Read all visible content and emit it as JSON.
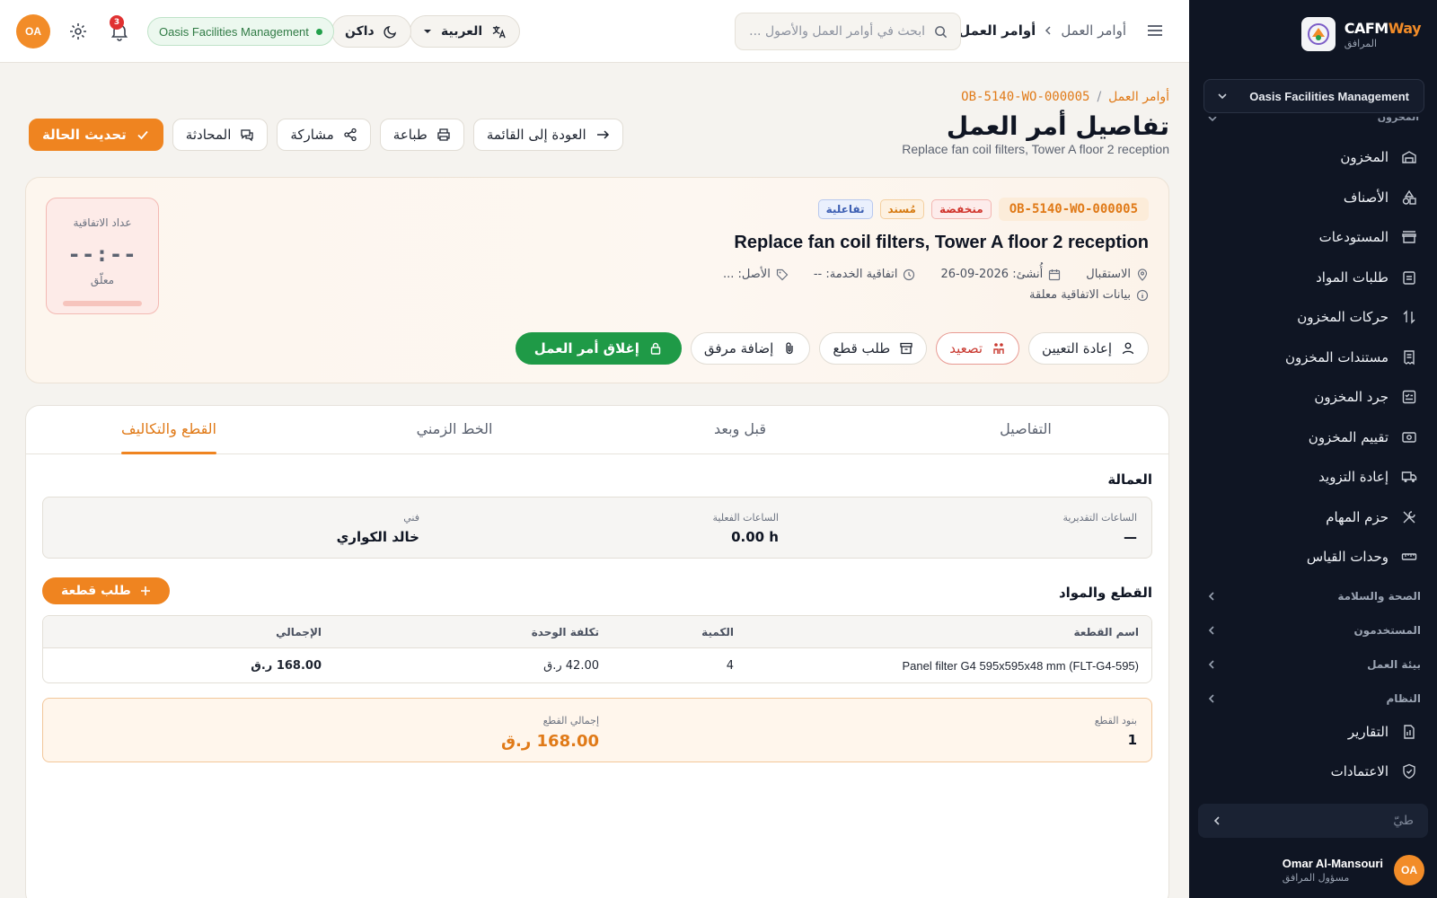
{
  "app": {
    "brand_prefix": "CAFM",
    "brand_suffix": "Way",
    "brand_sub": "المرافق"
  },
  "sidebar": {
    "org": "Oasis Facilities Management",
    "cut_label": "المخزون",
    "items": [
      {
        "label": "المخزون",
        "icon": "warehouse-icon"
      },
      {
        "label": "الأصناف",
        "icon": "shapes-icon"
      },
      {
        "label": "المستودعات",
        "icon": "store-icon"
      },
      {
        "label": "طلبات المواد",
        "icon": "clipboard-icon"
      },
      {
        "label": "حركات المخزون",
        "icon": "arrows-updown-icon"
      },
      {
        "label": "مستندات المخزون",
        "icon": "receipt-icon"
      },
      {
        "label": "جرد المخزون",
        "icon": "checklist-icon"
      },
      {
        "label": "تقييم المخزون",
        "icon": "coins-icon"
      },
      {
        "label": "إعادة التزويد",
        "icon": "truck-icon"
      },
      {
        "label": "حزم المهام",
        "icon": "tools-icon"
      },
      {
        "label": "وحدات القياس",
        "icon": "ruler-icon"
      }
    ],
    "groups": [
      "الصحة والسلامة",
      "المستخدمون",
      "بيئة العمل",
      "النظام"
    ],
    "bottom_items": [
      {
        "label": "التقارير",
        "icon": "report-icon"
      },
      {
        "label": "الاعتمادات",
        "icon": "shield-check-icon"
      }
    ],
    "search_placeholder": "طيّ",
    "user": {
      "initials": "OA",
      "name": "Omar Al-Mansouri",
      "role": "مسؤول المرافق"
    }
  },
  "topbar": {
    "breadcrumb_parent": "أوامر العمل",
    "breadcrumb_current": "أوامر العمل",
    "search_placeholder": "ابحث في أوامر العمل والأصول ...",
    "language": "العربية",
    "theme": "داكن",
    "org_badge": "Oasis Facilities Management",
    "notifications": "3",
    "user_initials": "OA"
  },
  "page": {
    "breadcrumb_root": "أوامر العمل",
    "breadcrumb_code": "OB-5140-WO-000005",
    "title": "تفاصيل أمر العمل",
    "subtitle": "Replace fan coil filters, Tower A floor 2 reception",
    "actions": {
      "update_status": "تحديث الحالة",
      "chat": "المحادثة",
      "share": "مشاركة",
      "print": "طباعة",
      "back": "العودة إلى القائمة"
    }
  },
  "work_order": {
    "code": "OB-5140-WO-000005",
    "priority": "منخفضة",
    "status": "مُسند",
    "type": "تفاعلية",
    "title": "Replace fan coil filters, Tower A floor 2 reception",
    "location": "الاستقبال",
    "created": "أُنشئ: 2026-09-26",
    "sla_agreement": "اتفاقية الخدمة: --",
    "asset": "الأصل: ...",
    "sla_note": "بيانات الاتفاقية معلقة",
    "buttons": {
      "reassign": "إعادة التعيين",
      "escalate": "تصعيد",
      "request_parts": "طلب قطع",
      "add_attachment": "إضافة مرفق",
      "close": "إغلاق أمر العمل"
    },
    "sla_counter": {
      "label": "عداد الاتفاقية",
      "value": "--:--",
      "state": "معلّق"
    }
  },
  "tabs": [
    "التفاصيل",
    "قبل وبعد",
    "الخط الزمني",
    "القطع والتكاليف"
  ],
  "labor": {
    "title": "العمالة",
    "estimated_label": "الساعات التقديرية",
    "estimated_value": "—",
    "actual_label": "الساعات الفعلية",
    "actual_value": "0.00 h",
    "tech_label": "فني",
    "tech_value": "خالد الكواري"
  },
  "parts": {
    "title": "القطع والمواد",
    "add_button": "طلب قطعة",
    "columns": [
      "اسم القطعة",
      "الكمية",
      "تكلفة الوحدة",
      "الإجمالي"
    ],
    "rows": [
      {
        "name": "Panel filter G4 595x595x48 mm (FLT-G4-595)",
        "qty": "4",
        "unit": "42.00 ر.ق",
        "total": "168.00 ر.ق"
      }
    ],
    "summary": {
      "lines_label": "بنود القطع",
      "lines_value": "1",
      "total_label": "إجمالي القطع",
      "total_value": "168.00 ر.ق"
    }
  },
  "colors": {
    "accent": "#ef8420",
    "sidebar": "#0f1523",
    "success": "#1f9a47",
    "danger": "#d0342c"
  }
}
